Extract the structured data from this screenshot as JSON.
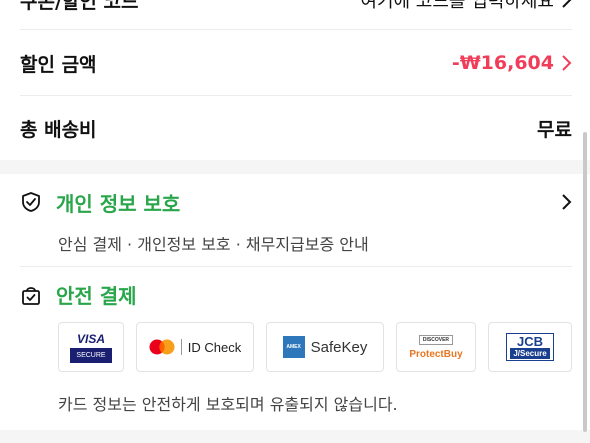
{
  "coupon_row": {
    "label": "쿠폰/할인 코드",
    "value": "여기에 코드를 입력하세요"
  },
  "discount_row": {
    "label": "할인 금액",
    "value": "-₩16,604"
  },
  "shipping_row": {
    "label": "총 배송비",
    "value": "무료"
  },
  "privacy": {
    "title": "개인 정보 보호",
    "subtitle": "안심 결제 · 개인정보 보호 · 채무지급보증 안내"
  },
  "secure_payment": {
    "title": "안전 결제",
    "cards": {
      "visa_brand": "VISA",
      "visa_secure": "SECURE",
      "mastercard": "ID Check",
      "amex": "SafeKey",
      "discover_brand": "DISCOVER",
      "discover_protect": "ProtectBuy",
      "jcb_brand": "JCB",
      "jcb_secure": "J/Secure"
    },
    "note": "카드 정보는 안전하게 보호되며 유출되지 않습니다."
  },
  "colors": {
    "accent_green": "#2aa64a",
    "discount_red": "#f03e5a"
  },
  "icons": {
    "privacy": "shield-check-icon",
    "secure": "bag-check-icon",
    "chevron": "chevron-right-icon"
  }
}
